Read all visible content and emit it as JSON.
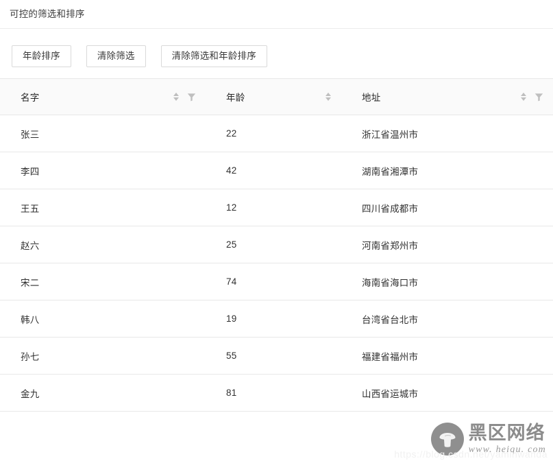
{
  "page": {
    "title": "可控的筛选和排序"
  },
  "toolbar": {
    "buttons": [
      {
        "label": "年龄排序",
        "name": "sort-age-button"
      },
      {
        "label": "清除筛选",
        "name": "clear-filters-button"
      },
      {
        "label": "清除筛选和年龄排序",
        "name": "clear-filters-and-sorters-button"
      }
    ]
  },
  "table": {
    "columns": [
      {
        "key": "name",
        "label": "名字",
        "sortable": true,
        "filterable": true
      },
      {
        "key": "age",
        "label": "年龄",
        "sortable": true,
        "filterable": false
      },
      {
        "key": "address",
        "label": "地址",
        "sortable": true,
        "filterable": true
      }
    ],
    "rows": [
      {
        "name": "张三",
        "age": "22",
        "address": "浙江省温州市"
      },
      {
        "name": "李四",
        "age": "42",
        "address": "湖南省湘潭市"
      },
      {
        "name": "王五",
        "age": "12",
        "address": "四川省成都市"
      },
      {
        "name": "赵六",
        "age": "25",
        "address": "河南省郑州市"
      },
      {
        "name": "宋二",
        "age": "74",
        "address": "海南省海口市"
      },
      {
        "name": "韩八",
        "age": "19",
        "address": "台湾省台北市"
      },
      {
        "name": "孙七",
        "age": "55",
        "address": "福建省福州市"
      },
      {
        "name": "金九",
        "age": "81",
        "address": "山西省运城市"
      }
    ]
  },
  "watermark": {
    "brand": "黑区网络",
    "url": "www. heiqu. com",
    "faint": "https://blog.csdn.net/yaminwanda"
  },
  "colors": {
    "header_bg": "#fafafa",
    "border": "#e8e8e8",
    "button_border": "#d9d9d9",
    "icon_gray": "#bfbfbf",
    "text": "#000000"
  }
}
